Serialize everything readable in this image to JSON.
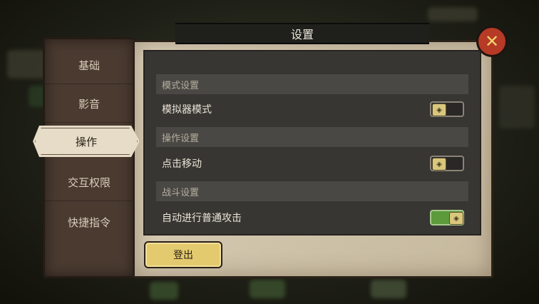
{
  "window": {
    "title": "设置"
  },
  "sidebar": {
    "items": [
      {
        "label": "基础"
      },
      {
        "label": "影音"
      },
      {
        "label": "操作"
      },
      {
        "label": "交互权限"
      },
      {
        "label": "快捷指令"
      }
    ],
    "active": "操作"
  },
  "content": {
    "sections": [
      {
        "title": "模式设置",
        "options": [
          {
            "label": "模拟器模式",
            "enabled": false
          }
        ]
      },
      {
        "title": "操作设置",
        "options": [
          {
            "label": "点击移动",
            "enabled": false
          }
        ]
      },
      {
        "title": "战斗设置",
        "options": [
          {
            "label": "自动进行普通攻击",
            "enabled": true
          }
        ]
      }
    ]
  },
  "buttons": {
    "logout": "登出",
    "close_icon": "close-x-icon"
  },
  "colors": {
    "accent_yellow": "#e4ca6e",
    "toggle_on": "#5c9a3c",
    "close_red": "#b63a26"
  }
}
